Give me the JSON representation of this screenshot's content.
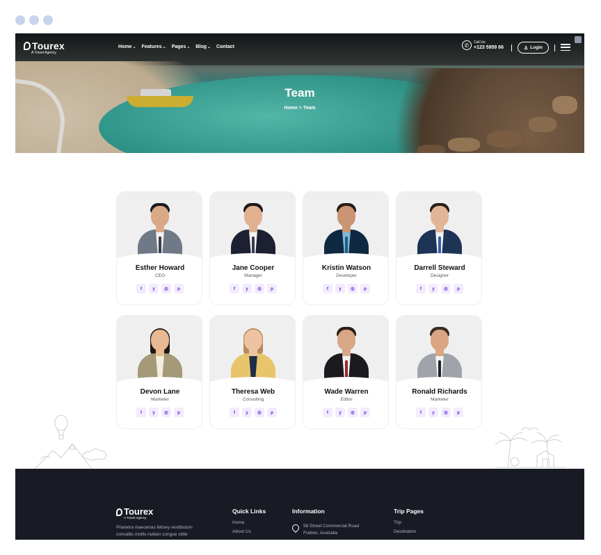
{
  "nav": {
    "brand": "Tourex",
    "tagline": "A Travel Agency",
    "menu": [
      {
        "label": "Home",
        "dropdown": true
      },
      {
        "label": "Features",
        "dropdown": true
      },
      {
        "label": "Pages",
        "dropdown": true
      },
      {
        "label": "Blog",
        "dropdown": true
      },
      {
        "label": "Contact",
        "dropdown": false
      }
    ],
    "call_label": "Call Us:",
    "phone": "+123 5959 66",
    "login": "Login"
  },
  "hero": {
    "title": "Team",
    "breadcrumb": "Home > Team"
  },
  "team": [
    {
      "name": "Esther Howard",
      "role": "CEO",
      "suit": "#6f7a86",
      "shirt": "#f2f2f2",
      "tie": "#3b3f46",
      "hair": "#1e1a18",
      "skin": "#d9a884",
      "long": false
    },
    {
      "name": "Jane Cooper",
      "role": "Manager",
      "suit": "#1c2030",
      "shirt": "#f2f2f2",
      "tie": "#3a3d52",
      "hair": "#1b1a1a",
      "skin": "#e0b090",
      "long": false
    },
    {
      "name": "Kristin Watson",
      "role": "Developer",
      "suit": "#0f2942",
      "shirt": "#7fb6d8",
      "tie": "#1d5e86",
      "hair": "#2a1e16",
      "skin": "#c99572",
      "long": false
    },
    {
      "name": "Darrell Steward",
      "role": "Designer",
      "suit": "#1d3457",
      "shirt": "#f2f2f2",
      "tie": "#2f5fa7",
      "hair": "#2b1f17",
      "skin": "#e3b597",
      "long": false
    },
    {
      "name": "Devon Lane",
      "role": "Marketer",
      "suit": "#a49a77",
      "shirt": "#f3ede0",
      "tie": "#f3ede0",
      "hair": "#1d1714",
      "skin": "#e6b994",
      "long": true
    },
    {
      "name": "Theresa Web",
      "role": "Consulting",
      "suit": "#e8c46b",
      "shirt": "#1f2d47",
      "tie": "#1f2d47",
      "hair": "#b78a5a",
      "skin": "#eec3a3",
      "long": true
    },
    {
      "name": "Wade Warren",
      "role": "Editor",
      "suit": "#1a1a1f",
      "shirt": "#f2f2f2",
      "tie": "#9e2430",
      "hair": "#2b1d15",
      "skin": "#d8a786",
      "long": false
    },
    {
      "name": "Ronald Richards",
      "role": "Marketer",
      "suit": "#9fa4ab",
      "shirt": "#f2f2f2",
      "tie": "#202226",
      "hair": "#3a2a1f",
      "skin": "#d9a582",
      "long": false
    }
  ],
  "social_icons": [
    {
      "name": "facebook-icon",
      "glyph": "f"
    },
    {
      "name": "twitter-icon",
      "glyph": "y"
    },
    {
      "name": "instagram-icon",
      "glyph": "◎"
    },
    {
      "name": "pinterest-icon",
      "glyph": "p"
    }
  ],
  "footer": {
    "brand": "Tourex",
    "tagline": "A Travel Agency",
    "description": "Pharetra maecenas felisey vestibulum convallis mollis nullam congue sittle",
    "quick_links": {
      "heading": "Quick Links",
      "links": [
        "Home",
        "About Us"
      ]
    },
    "information": {
      "heading": "Information",
      "address_line1": "58 Street Commercial Road",
      "address_line2": "Fratton, Australia"
    },
    "trip_pages": {
      "heading": "Trip Pages",
      "links": [
        "Trip",
        "Destination"
      ]
    }
  }
}
